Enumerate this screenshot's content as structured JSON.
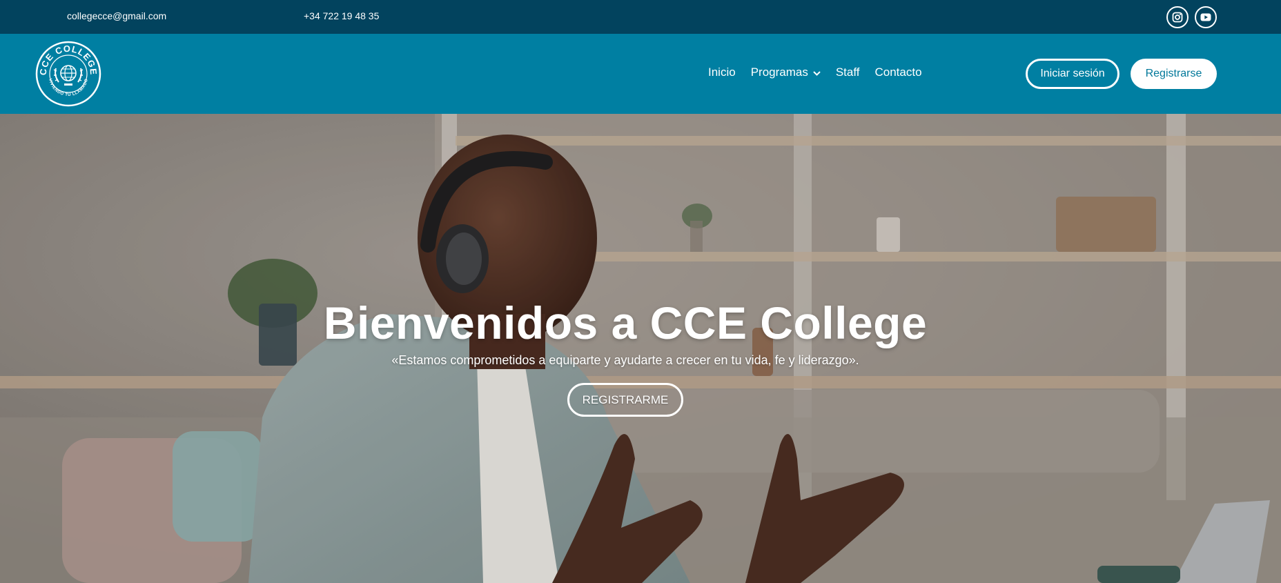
{
  "topbar": {
    "email": "collegecce@gmail.com",
    "phone": "+34 722 19 48 35",
    "social": [
      {
        "icon": "instagram-icon"
      },
      {
        "icon": "youtube-icon"
      }
    ]
  },
  "nav": {
    "logo": {
      "text_top": "CCE COLLEGE",
      "text_bottom": "VIVIENDO TU LLAMADO"
    },
    "items": [
      {
        "label": "Inicio"
      },
      {
        "label": "Programas",
        "has_dropdown": true
      },
      {
        "label": "Staff"
      },
      {
        "label": "Contacto"
      }
    ],
    "login_label": "Iniciar sesión",
    "register_label": "Registrarse"
  },
  "hero": {
    "title": "Bienvenidos a CCE College",
    "subtitle": "«Estamos comprometidos a equiparte y ayudarte a crecer en tu vida, fe y liderazgo».",
    "cta_label": "REGISTRARME"
  },
  "colors": {
    "topbar_bg": "#02435e",
    "nav_bg": "#007fa2",
    "white": "#ffffff",
    "accent_text": "#00789a"
  }
}
